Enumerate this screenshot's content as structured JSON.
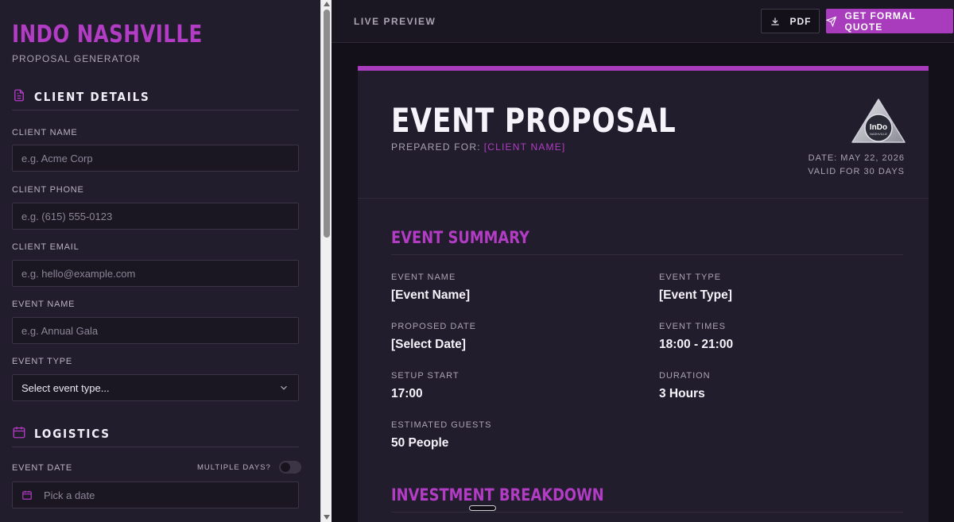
{
  "brand": {
    "title": "INDO NASHVILLE",
    "subtitle": "PROPOSAL GENERATOR"
  },
  "sidebar": {
    "client_section": {
      "title": "CLIENT DETAILS",
      "icon": "document-icon"
    },
    "fields": [
      {
        "label": "CLIENT NAME",
        "placeholder": "e.g. Acme Corp"
      },
      {
        "label": "CLIENT PHONE",
        "placeholder": "e.g. (615) 555-0123"
      },
      {
        "label": "CLIENT EMAIL",
        "placeholder": "e.g. hello@example.com"
      },
      {
        "label": "EVENT NAME",
        "placeholder": "e.g. Annual Gala"
      },
      {
        "label": "EVENT TYPE",
        "value": "Select event type..."
      }
    ],
    "logistics_section": {
      "title": "LOGISTICS",
      "icon": "calendar-icon"
    },
    "event_date": {
      "label": "EVENT DATE",
      "placeholder": "Pick a date",
      "multiple_days_label": "MULTIPLE DAYS?",
      "multiple_days": false
    }
  },
  "preview": {
    "label": "LIVE PREVIEW",
    "pdf_button": "PDF",
    "quote_button": "GET FORMAL QUOTE"
  },
  "document": {
    "title": "EVENT PROPOSAL",
    "prepared_for_label": "PREPARED FOR:",
    "client_placeholder": "[CLIENT NAME]",
    "date": "DATE: MAY 22, 2026",
    "valid": "VALID FOR 30 DAYS",
    "logo_text": "InDo",
    "logo_sub": "NASHVILLE",
    "summary_title": "EVENT SUMMARY",
    "summary": [
      {
        "key": "EVENT NAME",
        "value": "[Event Name]"
      },
      {
        "key": "EVENT TYPE",
        "value": "[Event Type]"
      },
      {
        "key": "PROPOSED DATE",
        "value": "[Select Date]"
      },
      {
        "key": "EVENT TIMES",
        "value": "18:00 - 21:00"
      },
      {
        "key": "SETUP START",
        "value": "17:00"
      },
      {
        "key": "DURATION",
        "value": "3 Hours"
      },
      {
        "key": "ESTIMATED GUESTS",
        "value": "50 People"
      }
    ],
    "investment_title": "INVESTMENT BREAKDOWN"
  },
  "colors": {
    "accent": "#a83cbd",
    "sidebar_bg": "#221d2c",
    "page_bg": "#13101a"
  }
}
